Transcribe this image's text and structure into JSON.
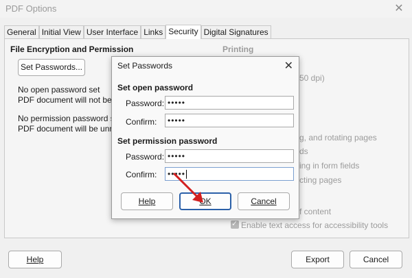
{
  "window": {
    "title": "PDF Options"
  },
  "tabs": [
    "General",
    "Initial View",
    "User Interface",
    "Links",
    "Security",
    "Digital Signatures"
  ],
  "active_tab": "Security",
  "left": {
    "section_title": "File Encryption and Permission",
    "set_passwords_label": "Set Passwords...",
    "open_status_1": "No open password set",
    "open_status_2": "PDF document will not be e",
    "perm_status_1": "No permission password set",
    "perm_status_2": "PDF document will be unres"
  },
  "right": {
    "printing_title": "Printing",
    "dpi_text": "50 dpi)",
    "item_rotating": "g, and rotating pages",
    "item_ds": "ds",
    "item_form": "ing in form fields",
    "item_extract": "cting pages",
    "item_content": "f content",
    "item_access": "Enable text access for accessibility tools"
  },
  "bottom": {
    "help": "Help",
    "export": "Export",
    "cancel": "Cancel"
  },
  "dialog": {
    "title": "Set Passwords",
    "open_section": "Set open password",
    "perm_section": "Set permission password",
    "password_label": "Password:",
    "confirm_label": "Confirm:",
    "open_password": "•••••",
    "open_confirm": "•••••",
    "perm_password": "•••••",
    "perm_confirm": "•••••",
    "help": "Help",
    "ok": "OK",
    "cancel": "Cancel"
  },
  "colors": {
    "accent": "#2a5fa8",
    "arrow": "#d21f1f"
  }
}
